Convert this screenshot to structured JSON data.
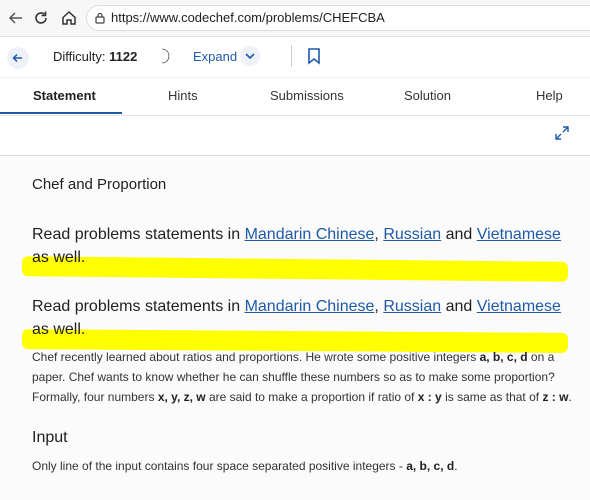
{
  "browser": {
    "url": "https://www.codechef.com/problems/CHEFCBA"
  },
  "toolbar": {
    "difficulty_label": "Difficulty:",
    "difficulty_value": "1122",
    "expand_label": "Expand"
  },
  "tabs": [
    {
      "label": "Statement",
      "active": true
    },
    {
      "label": "Hints"
    },
    {
      "label": "Submissions"
    },
    {
      "label": "Solution"
    },
    {
      "label": "Help"
    }
  ],
  "problem": {
    "title": "Chef and Proportion",
    "read_statements": {
      "prefix": "Read problems statements in",
      "link1": "Mandarin Chinese",
      "comma": ",",
      "link2": "Russian",
      "and": "and",
      "link3": "Vietnamese",
      "suffix": "as well."
    },
    "paragraph": {
      "p1": "Chef recently learned about ratios and proportions. He wrote some positive integers ",
      "b1": "a, b, c, d",
      "p2": " on a paper. Chef wants to know whether he can shuffle these numbers so as to make some proportion? Formally, four numbers ",
      "b2": "x, y, z, w",
      "p3": " are said to make a proportion if ratio of ",
      "b3": "x : y",
      "p4": " is same as that of ",
      "b4": "z : w",
      "p5": "."
    },
    "input_heading": "Input",
    "input_text": {
      "p1": "Only line of the input contains four space separated positive integers - ",
      "b1": "a, b, c, d",
      "p2": "."
    }
  },
  "colors": {
    "link": "#1e5aa8",
    "highlight": "#ffff00"
  }
}
